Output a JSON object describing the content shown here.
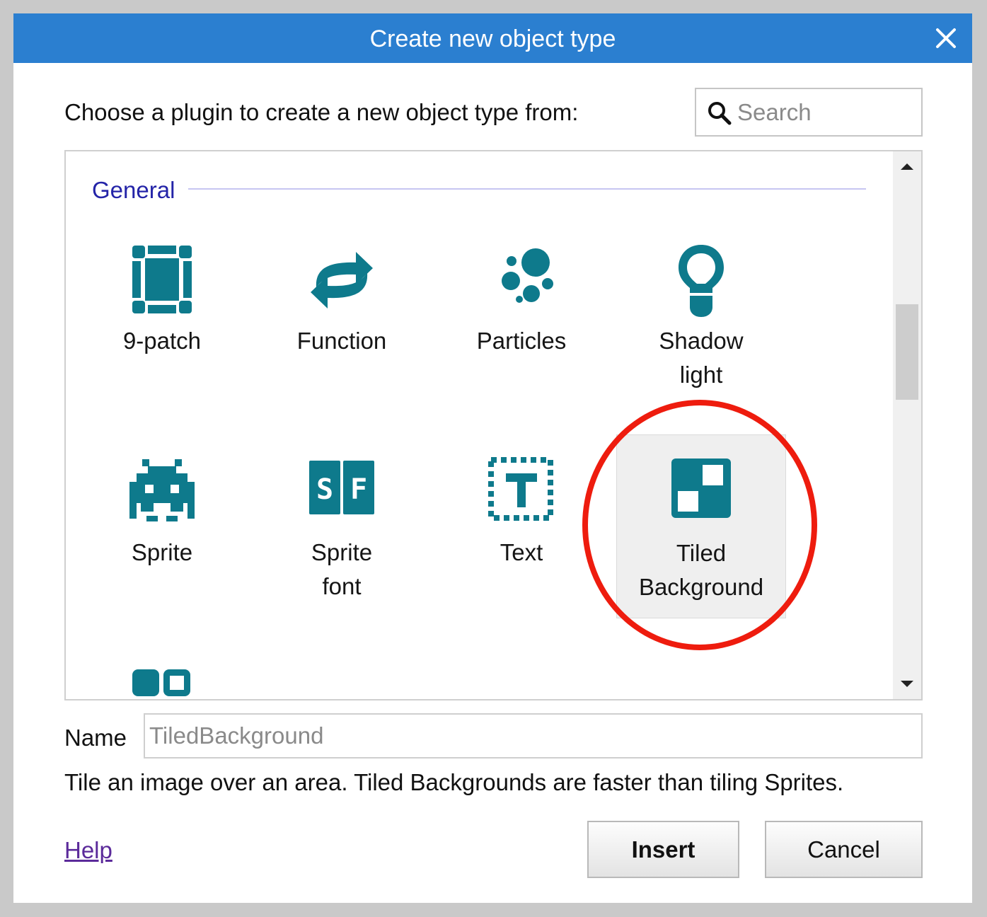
{
  "window": {
    "title": "Create new object type"
  },
  "prompt": "Choose a plugin to create a new object type from:",
  "search": {
    "placeholder": "Search",
    "value": ""
  },
  "group": {
    "label": "General"
  },
  "plugins": [
    {
      "label": "9-patch",
      "icon": "nine-patch-icon"
    },
    {
      "label": "Function",
      "icon": "function-icon"
    },
    {
      "label": "Particles",
      "icon": "particles-icon"
    },
    {
      "label": "Shadow\nlight",
      "icon": "shadow-light-icon"
    },
    {
      "label": "Sprite",
      "icon": "sprite-icon"
    },
    {
      "label": "Sprite\nfont",
      "icon": "sprite-font-icon"
    },
    {
      "label": "Text",
      "icon": "text-icon"
    },
    {
      "label": "Tiled\nBackground",
      "icon": "tiled-background-icon",
      "selected": true
    }
  ],
  "partial_next_icon": "toggle-icon",
  "name": {
    "label": "Name",
    "placeholder": "TiledBackground",
    "value": ""
  },
  "description": "Tile an image over an area. Tiled Backgrounds are faster than tiling Sprites.",
  "footer": {
    "help": "Help",
    "insert": "Insert",
    "cancel": "Cancel"
  },
  "colors": {
    "titlebar": "#2b7fd0",
    "icon": "#0e7a8c",
    "group_label": "#2424a8",
    "highlight_ring": "#ee1c0e"
  }
}
